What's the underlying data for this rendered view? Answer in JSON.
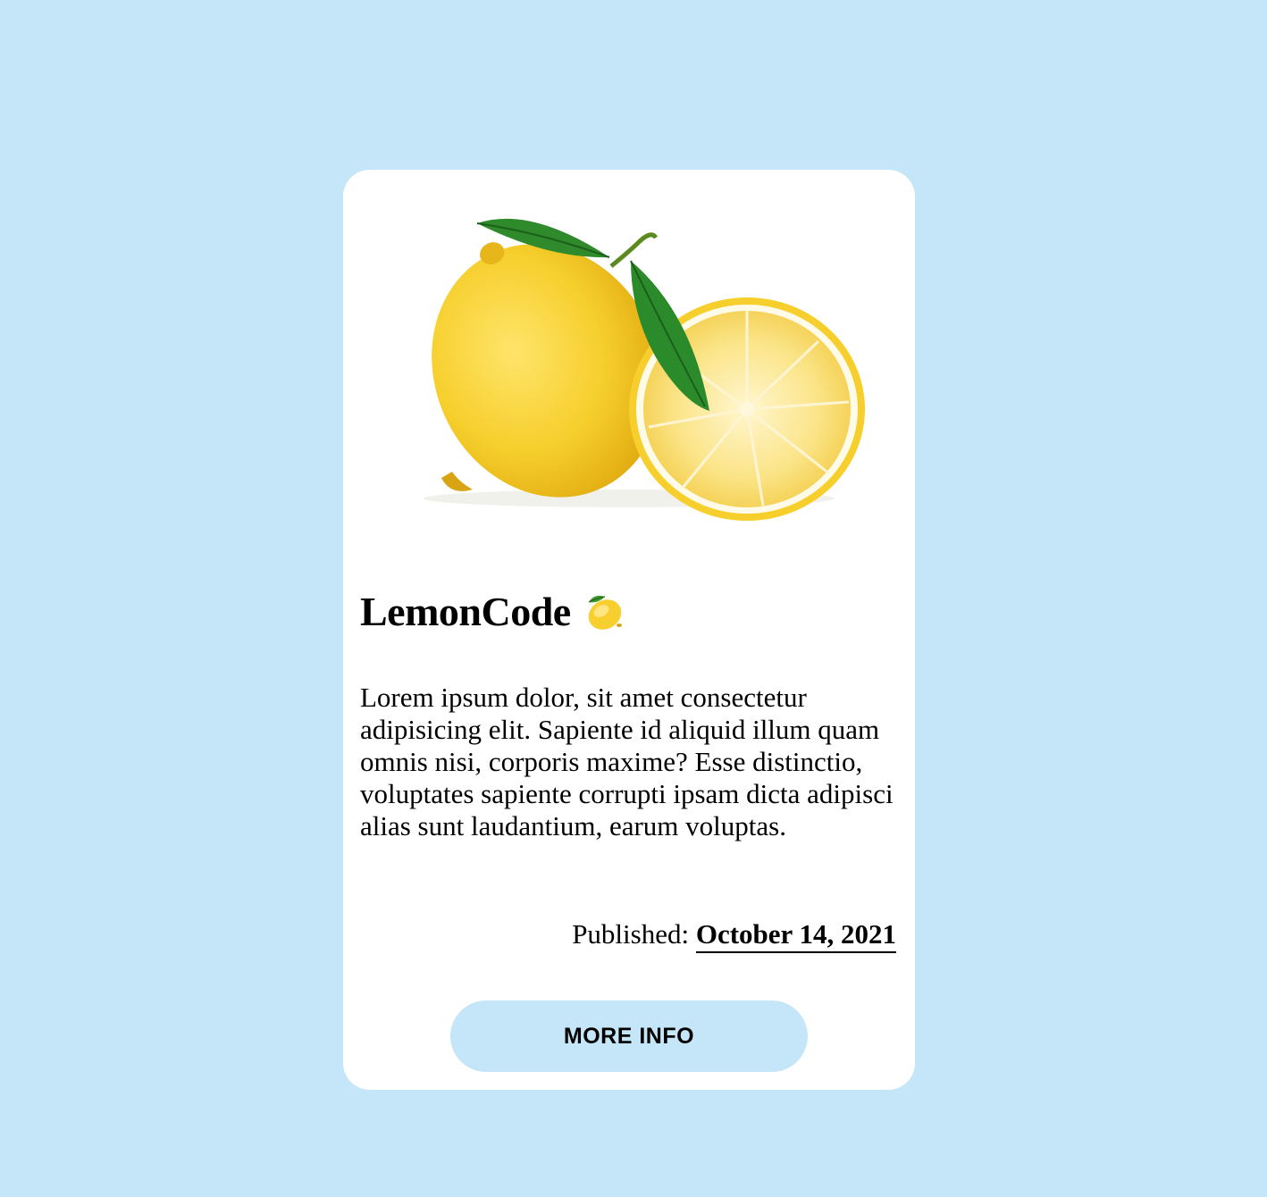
{
  "card": {
    "image_alt": "lemons-image",
    "title": "LemonCode",
    "title_icon": "lemon-icon",
    "description": "Lorem ipsum dolor, sit amet consectetur adipisicing elit. Sapiente id aliquid illum quam omnis nisi, corporis maxime? Esse distinctio, voluptates sapiente corrupti ipsam dicta adipisci alias sunt laudantium, earum voluptas.",
    "published_label": "Published:",
    "published_date": "October 14, 2021",
    "button_label": "MORE INFO"
  },
  "colors": {
    "background": "#c4e6f8",
    "card": "#ffffff",
    "button": "#c4e6f8",
    "lemon": "#f7cf2e",
    "leaf": "#2f8a2c"
  }
}
